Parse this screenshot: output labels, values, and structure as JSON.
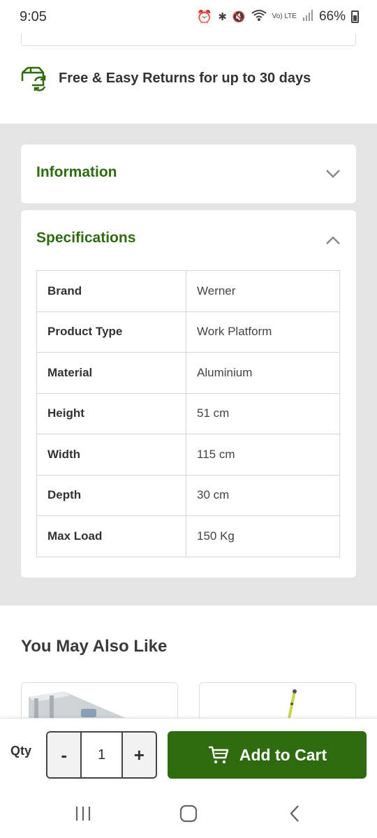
{
  "status_bar": {
    "time": "9:05",
    "battery": "66%",
    "icons": [
      "alarm-icon",
      "bluetooth-icon",
      "mute-icon",
      "wifi-icon",
      "volte-icon",
      "signal-icon",
      "battery-icon"
    ],
    "volte_label": "Vo) LTE"
  },
  "returns": {
    "text": "Free & Easy Returns for up to 30 days",
    "icon": "box-return-icon"
  },
  "accordion": {
    "information": {
      "title": "Information",
      "expanded": false
    },
    "specifications": {
      "title": "Specifications",
      "expanded": true
    }
  },
  "specs": [
    {
      "label": "Brand",
      "value": "Werner"
    },
    {
      "label": "Product Type",
      "value": "Work Platform"
    },
    {
      "label": "Material",
      "value": "Aluminium"
    },
    {
      "label": "Height",
      "value": "51 cm"
    },
    {
      "label": "Width",
      "value": "115 cm"
    },
    {
      "label": "Depth",
      "value": "30 cm"
    },
    {
      "label": "Max Load",
      "value": "150 Kg"
    }
  ],
  "recommendations": {
    "title": "You May Also Like"
  },
  "cart_bar": {
    "qty_label": "Qty",
    "minus": "-",
    "quantity": "1",
    "plus": "+",
    "add_to_cart": "Add to Cart"
  },
  "colors": {
    "brand_green": "#2e6b0f",
    "panel_grey": "#e5e5e5"
  }
}
